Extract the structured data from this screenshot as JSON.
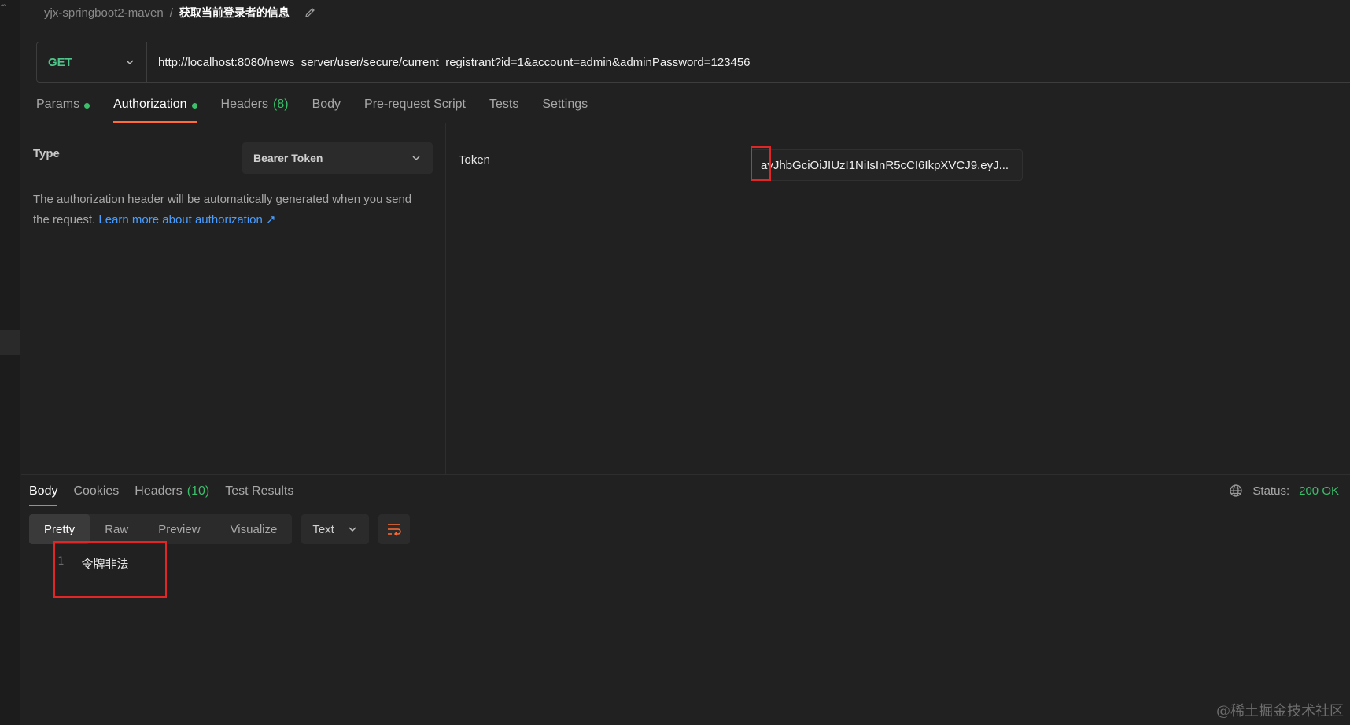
{
  "breadcrumb": {
    "collection": "yjx-springboot2-maven",
    "separator": "/",
    "request_name": "获取当前登录者的信息"
  },
  "request": {
    "method": "GET",
    "url": "http://localhost:8080/news_server/user/secure/current_registrant?id=1&account=admin&adminPassword=123456"
  },
  "request_tabs": [
    {
      "label": "Params",
      "dot": true
    },
    {
      "label": "Authorization",
      "dot": true,
      "active": true
    },
    {
      "label": "Headers",
      "count": "(8)"
    },
    {
      "label": "Body"
    },
    {
      "label": "Pre-request Script"
    },
    {
      "label": "Tests"
    },
    {
      "label": "Settings"
    }
  ],
  "auth": {
    "type_label": "Type",
    "type_value": "Bearer Token",
    "description": "The authorization header will be automatically generated when you send the request.",
    "learn_more": "Learn more about authorization ↗",
    "token_label": "Token",
    "token_value": "ayJhbGciOiJIUzI1NiIsInR5cCI6IkpXVCJ9.eyJ..."
  },
  "response_tabs": [
    {
      "label": "Body",
      "active": true
    },
    {
      "label": "Cookies"
    },
    {
      "label": "Headers",
      "count": "(10)"
    },
    {
      "label": "Test Results"
    }
  ],
  "status": {
    "label": "Status:",
    "value": "200 OK"
  },
  "response_view": {
    "modes": [
      "Pretty",
      "Raw",
      "Preview",
      "Visualize"
    ],
    "active_mode": "Pretty",
    "format": "Text"
  },
  "response_body": {
    "line_number": "1",
    "content": "令牌非法"
  },
  "watermark": "@稀土掘金技术社区",
  "colors": {
    "accent": "#ff6c37",
    "method_get": "#4fc48a",
    "success": "#3bbf6b",
    "link": "#4a9eff",
    "highlight": "#e02626"
  }
}
